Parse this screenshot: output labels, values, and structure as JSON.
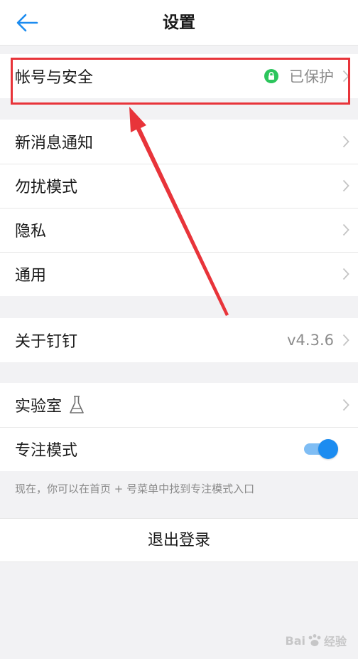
{
  "header": {
    "title": "设置",
    "back_icon": "back-arrow-icon"
  },
  "groups": {
    "account": {
      "label": "帐号与安全",
      "status": "已保护",
      "status_icon": "lock-icon",
      "status_color": "#2cc55c"
    },
    "notifications": {
      "label": "新消息通知"
    },
    "dnd": {
      "label": "勿扰模式"
    },
    "privacy": {
      "label": "隐私"
    },
    "general": {
      "label": "通用"
    },
    "about": {
      "label": "关于钉钉",
      "version": "v4.3.6"
    },
    "lab": {
      "label": "实验室",
      "icon": "flask-icon"
    },
    "focus": {
      "label": "专注模式",
      "enabled": true
    }
  },
  "focus_hint": "现在，你可以在首页 + 号菜单中找到专注模式入口",
  "logout_label": "退出登录",
  "annotation": {
    "color": "#e8343a"
  },
  "watermark": {
    "left": "Bai",
    "right": "经验"
  },
  "colors": {
    "accent": "#1c8cf0",
    "background": "#f2f2f4"
  }
}
